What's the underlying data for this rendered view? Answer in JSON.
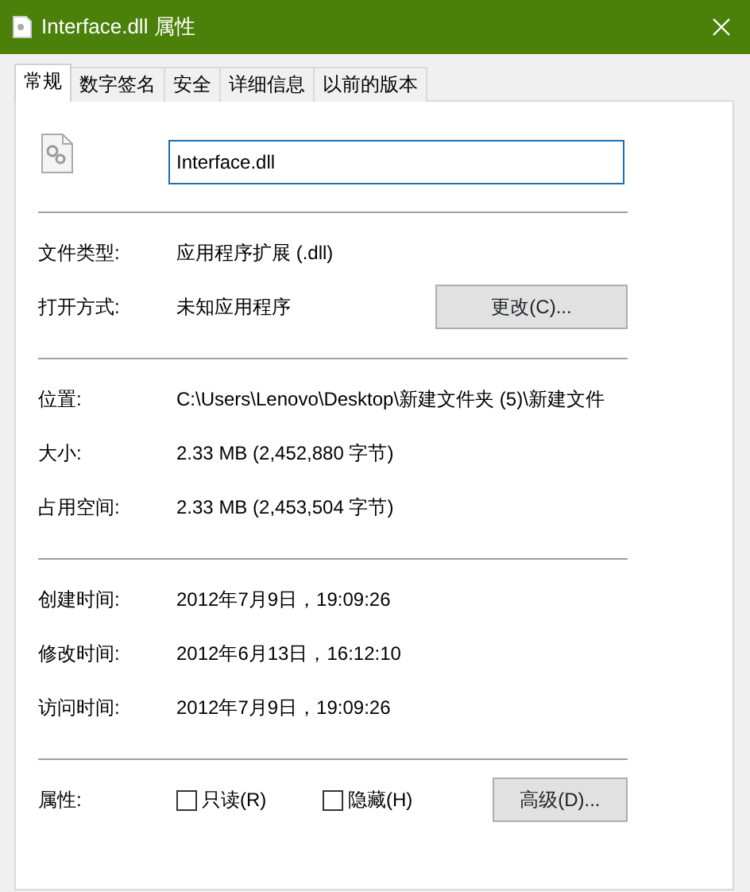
{
  "window": {
    "title": "Interface.dll 属性"
  },
  "tabs": [
    {
      "label": "常规",
      "selected": true
    },
    {
      "label": "数字签名",
      "selected": false
    },
    {
      "label": "安全",
      "selected": false
    },
    {
      "label": "详细信息",
      "selected": false
    },
    {
      "label": "以前的版本",
      "selected": false
    }
  ],
  "file_name": {
    "value": "Interface.dll"
  },
  "sections": [
    [
      {
        "label": "文件类型:",
        "value": "应用程序扩展 (.dll)"
      },
      {
        "label": "打开方式:",
        "value": "未知应用程序",
        "button": "更改(C)..."
      }
    ],
    [
      {
        "label": "位置:",
        "value": "C:\\Users\\Lenovo\\Desktop\\新建文件夹 (5)\\新建文件"
      },
      {
        "label": "大小:",
        "value": "2.33 MB (2,452,880 字节)"
      },
      {
        "label": "占用空间:",
        "value": "2.33 MB (2,453,504 字节)"
      }
    ],
    [
      {
        "label": "创建时间:",
        "value": "2012年7月9日，19:09:26"
      },
      {
        "label": "修改时间:",
        "value": "2012年6月13日，16:12:10"
      },
      {
        "label": "访问时间:",
        "value": "2012年7月9日，19:09:26"
      }
    ]
  ],
  "attributes": {
    "label": "属性:",
    "checkboxes": [
      {
        "label": "只读(R)",
        "checked": false
      },
      {
        "label": "隐藏(H)",
        "checked": false
      }
    ],
    "button": "高级(D)..."
  }
}
